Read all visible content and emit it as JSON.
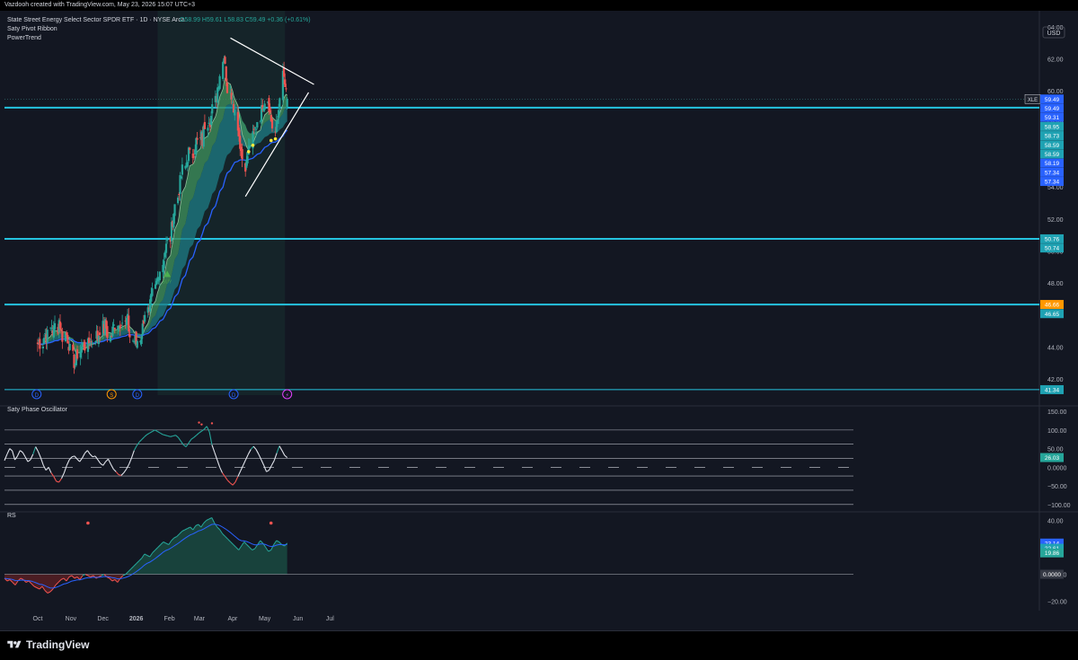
{
  "header": {
    "credit": "Vazdooh created with TradingView.com, May 23, 2026 15:07 UTC+3"
  },
  "footer": {
    "brand": "TradingView"
  },
  "currency": "USD",
  "colors": {
    "bg": "#131722",
    "grid": "#2a2e39",
    "up": "#26a69a",
    "down": "#ef5350",
    "level": "#25c4e0",
    "ema": "#2962ff",
    "ribbon": "#3c8c5a",
    "cloud": "#1d7c86"
  },
  "chart_data": [
    {
      "type": "candlestick",
      "title": "State Street Energy Select Sector SPDR ETF · 1D · NYSE Arca",
      "symbol": "XLE",
      "ohlc_label": {
        "o": "58.99",
        "h": "59.61",
        "l": "58.83",
        "c": "59.49",
        "change": "+0.36 (+0.61%)"
      },
      "indicators": [
        "Saty Pivot Ribbon",
        "PowerTrend"
      ],
      "x_tick_labels": [
        "Oct",
        "Nov",
        "Dec",
        "2026",
        "Feb",
        "Mar",
        "Apr",
        "May",
        "Jun",
        "Jul"
      ],
      "y_tick_labels": [
        "64.00",
        "62.00",
        "60.00",
        "58.00",
        "56.00",
        "54.00",
        "52.00",
        "50.00",
        "48.00",
        "46.00",
        "44.00",
        "42.00"
      ],
      "ylim": [
        41.0,
        65.0
      ],
      "horizontal_levels": [
        58.95,
        50.76,
        46.66,
        41.34
      ],
      "price_labels": [
        {
          "text": "59.49",
          "kind": "price"
        },
        {
          "text": "59.49",
          "kind": "price"
        },
        {
          "text": "59.31",
          "kind": "ema"
        },
        {
          "text": "58.95",
          "kind": "level"
        },
        {
          "text": "58.73",
          "kind": "level"
        },
        {
          "text": "58.59",
          "kind": "ribbon"
        },
        {
          "text": "58.59",
          "kind": "ribbon"
        },
        {
          "text": "58.19",
          "kind": "ema"
        },
        {
          "text": "57.34",
          "kind": "ema"
        },
        {
          "text": "57.34",
          "kind": "ema"
        },
        {
          "text": "50.76",
          "kind": "level"
        },
        {
          "text": "50.74",
          "kind": "level"
        },
        {
          "text": "46.66",
          "kind": "orange"
        },
        {
          "text": "46.65",
          "kind": "level"
        },
        {
          "text": "41.34",
          "kind": "level"
        }
      ],
      "series_closes": [
        44.2,
        44.4,
        44.1,
        44.6,
        44.9,
        44.5,
        45.1,
        45.3,
        44.8,
        45.4,
        45.2,
        45.8,
        45.1,
        44.6,
        44.9,
        44.7,
        44.3,
        43.8,
        43.2,
        42.9,
        43.3,
        43.6,
        43.9,
        44.1,
        44.3,
        44.0,
        44.2,
        44.5,
        44.2,
        44.6,
        44.8,
        44.5,
        45.0,
        45.3,
        45.1,
        45.5,
        44.9,
        44.6,
        44.8,
        45.2,
        45.4,
        45.6,
        45.3,
        45.8,
        45.6,
        45.4,
        45.9,
        45.2,
        44.6,
        44.3,
        44.5,
        44.2,
        44.5,
        44.7,
        45.2,
        45.9,
        46.4,
        46.0,
        46.6,
        47.1,
        47.6,
        48.0,
        48.4,
        48.7,
        49.2,
        49.7,
        50.2,
        50.4,
        50.8,
        51.6,
        52.3,
        52.8,
        53.5,
        54.1,
        54.6,
        55.1,
        55.3,
        55.8,
        56.2,
        55.9,
        56.1,
        56.6,
        56.9,
        56.7,
        57.2,
        56.8,
        57.8,
        58.0,
        58.4,
        58.1,
        58.6,
        59.3,
        59.8,
        60.4,
        60.9,
        61.8,
        62.6,
        61.2,
        60.1,
        59.6,
        59.9,
        59.2,
        58.7,
        57.6,
        56.9,
        56.3,
        55.7,
        55.2,
        55.9,
        56.4,
        56.9,
        57.3,
        57.6,
        57.9,
        58.4,
        58.7,
        59.3,
        59.4,
        59.6,
        59.1,
        58.4,
        57.9,
        57.4,
        57.8,
        58.4,
        59.7,
        61.0,
        60.6,
        59.8,
        59.49
      ],
      "trendlines": [
        {
          "from": [
            "2026-03-30",
            63.3
          ],
          "to": [
            "2026-06-16",
            60.4
          ]
        },
        {
          "from": [
            "2026-04-13",
            53.4
          ],
          "to": [
            "2026-06-11",
            59.9
          ]
        }
      ],
      "markers": [
        "D",
        "S",
        "D",
        "D",
        "⚡"
      ],
      "buy_label": "BUY"
    },
    {
      "type": "line",
      "title": "Saty Phase Oscillator",
      "y_tick_labels": [
        "150.00",
        "100.00",
        "50.00",
        "0.0000",
        "−50.00",
        "−100.00"
      ],
      "ylim": [
        -115,
        160
      ],
      "levels": [
        100,
        61.8,
        23.6,
        0,
        -23.6,
        -61.8,
        -100
      ],
      "current_label": "26.03",
      "values": [
        18,
        35,
        50,
        44,
        20,
        30,
        45,
        40,
        28,
        15,
        20,
        35,
        55,
        42,
        25,
        5,
        -8,
        0,
        -15,
        -25,
        -38,
        -40,
        -30,
        -15,
        5,
        20,
        28,
        30,
        22,
        15,
        25,
        38,
        45,
        35,
        28,
        30,
        20,
        10,
        5,
        15,
        22,
        8,
        -5,
        -12,
        -20,
        -22,
        -15,
        -5,
        8,
        25,
        45,
        58,
        68,
        75,
        82,
        88,
        92,
        96,
        100,
        96,
        92,
        88,
        86,
        84,
        82,
        84,
        86,
        80,
        70,
        60,
        55,
        65,
        75,
        80,
        86,
        92,
        97,
        102,
        110,
        95,
        60,
        40,
        20,
        0,
        -15,
        -25,
        -35,
        -42,
        -48,
        -40,
        -25,
        -10,
        5,
        20,
        35,
        48,
        56,
        48,
        35,
        20,
        5,
        -12,
        -8,
        5,
        18,
        38,
        57,
        45,
        32,
        26.03
      ]
    },
    {
      "type": "area",
      "title": "RS",
      "y_tick_labels": [
        "40.00",
        "20.00",
        "0.0000",
        "−20.00"
      ],
      "ylim": [
        -25,
        45
      ],
      "value_labels": [
        "23.14",
        "22.61",
        "19.86",
        "0.0000"
      ],
      "values": [
        -3,
        -5,
        -4,
        -6,
        -8,
        -5,
        -3,
        -4,
        -6,
        -5,
        -7,
        -9,
        -10,
        -11,
        -9,
        -12,
        -14,
        -13,
        -11,
        -8,
        -6,
        -4,
        -3,
        -5,
        -2,
        -1,
        -3,
        -2,
        -4,
        -1,
        0,
        -1,
        -2,
        -1,
        -3,
        -2,
        -1,
        0,
        -2,
        -3,
        -5,
        -4,
        -6,
        -3,
        -1,
        0,
        2,
        4,
        6,
        8,
        10,
        12,
        15,
        14,
        13,
        16,
        18,
        20,
        22,
        24,
        23,
        22,
        25,
        27,
        28,
        30,
        32,
        33,
        34,
        35,
        33,
        36,
        37,
        35,
        38,
        40,
        41,
        42,
        38,
        35,
        33,
        30,
        28,
        26,
        24,
        22,
        20,
        18,
        21,
        24,
        22,
        20,
        18,
        19,
        22,
        25,
        23,
        20,
        17,
        18,
        22,
        25,
        24,
        22,
        21,
        23.14
      ]
    }
  ]
}
